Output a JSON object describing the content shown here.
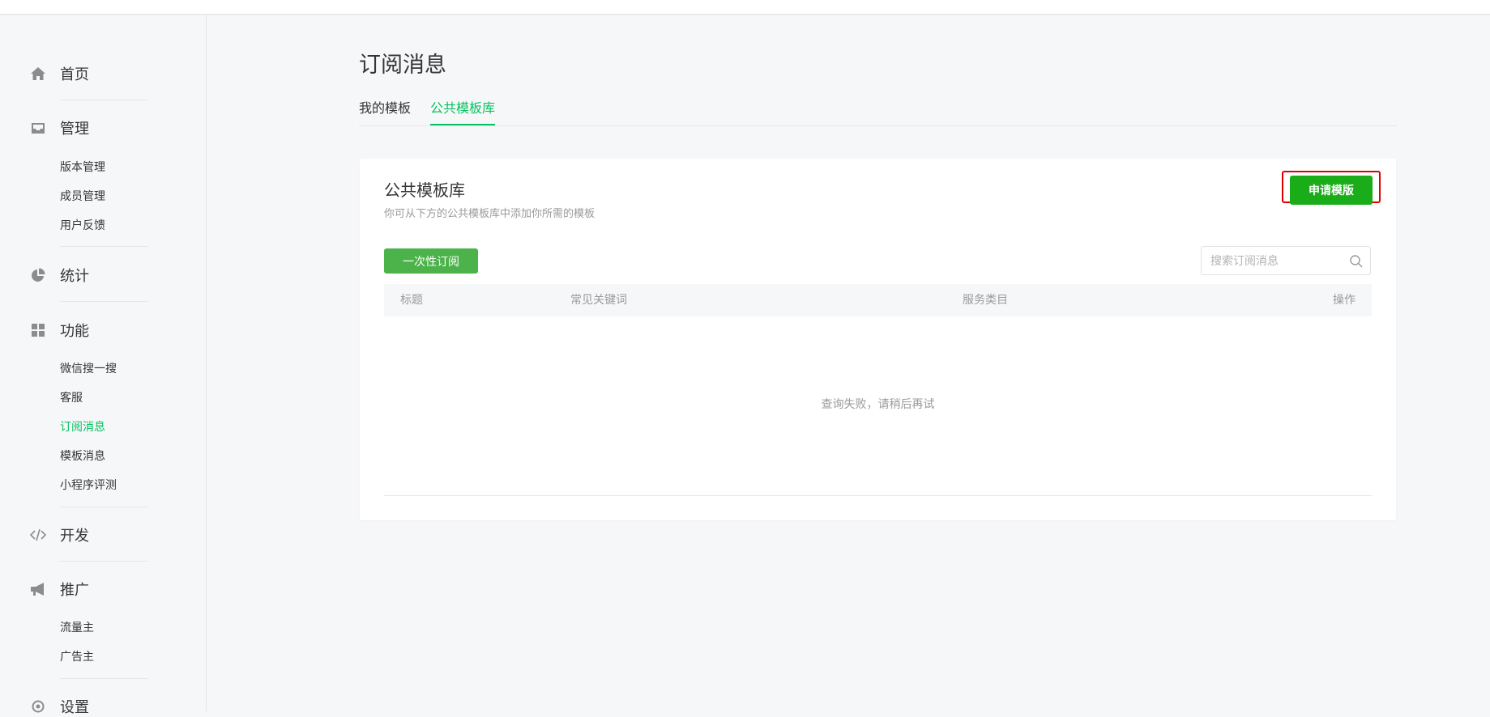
{
  "sidebar": {
    "home": {
      "label": "首页",
      "icon": "home-icon"
    },
    "manage": {
      "label": "管理",
      "icon": "inbox-icon",
      "items": [
        "版本管理",
        "成员管理",
        "用户反馈"
      ]
    },
    "stats": {
      "label": "统计",
      "icon": "pie-chart-icon"
    },
    "features": {
      "label": "功能",
      "icon": "grid-icon",
      "items": [
        "微信搜一搜",
        "客服",
        "订阅消息",
        "模板消息",
        "小程序评测"
      ],
      "active": "订阅消息"
    },
    "develop": {
      "label": "开发",
      "icon": "code-icon"
    },
    "promote": {
      "label": "推广",
      "icon": "megaphone-icon",
      "items": [
        "流量主",
        "广告主"
      ]
    },
    "settings": {
      "label": "设置",
      "icon": "gear-icon"
    }
  },
  "page": {
    "title": "订阅消息",
    "tabs": [
      {
        "label": "我的模板",
        "active": false
      },
      {
        "label": "公共模板库",
        "active": true
      }
    ]
  },
  "card": {
    "title": "公共模板库",
    "description": "你可从下方的公共模板库中添加你所需的模板",
    "apply_button": "申请模版",
    "once_button": "一次性订阅",
    "search_placeholder": "搜索订阅消息",
    "columns": [
      "标题",
      "常见关键词",
      "服务类目",
      "操作"
    ],
    "empty_message": "查询失败，请稍后再试"
  },
  "colors": {
    "accent_green": "#07c160",
    "button_green": "#1aad19",
    "highlight_red": "#e00000"
  }
}
